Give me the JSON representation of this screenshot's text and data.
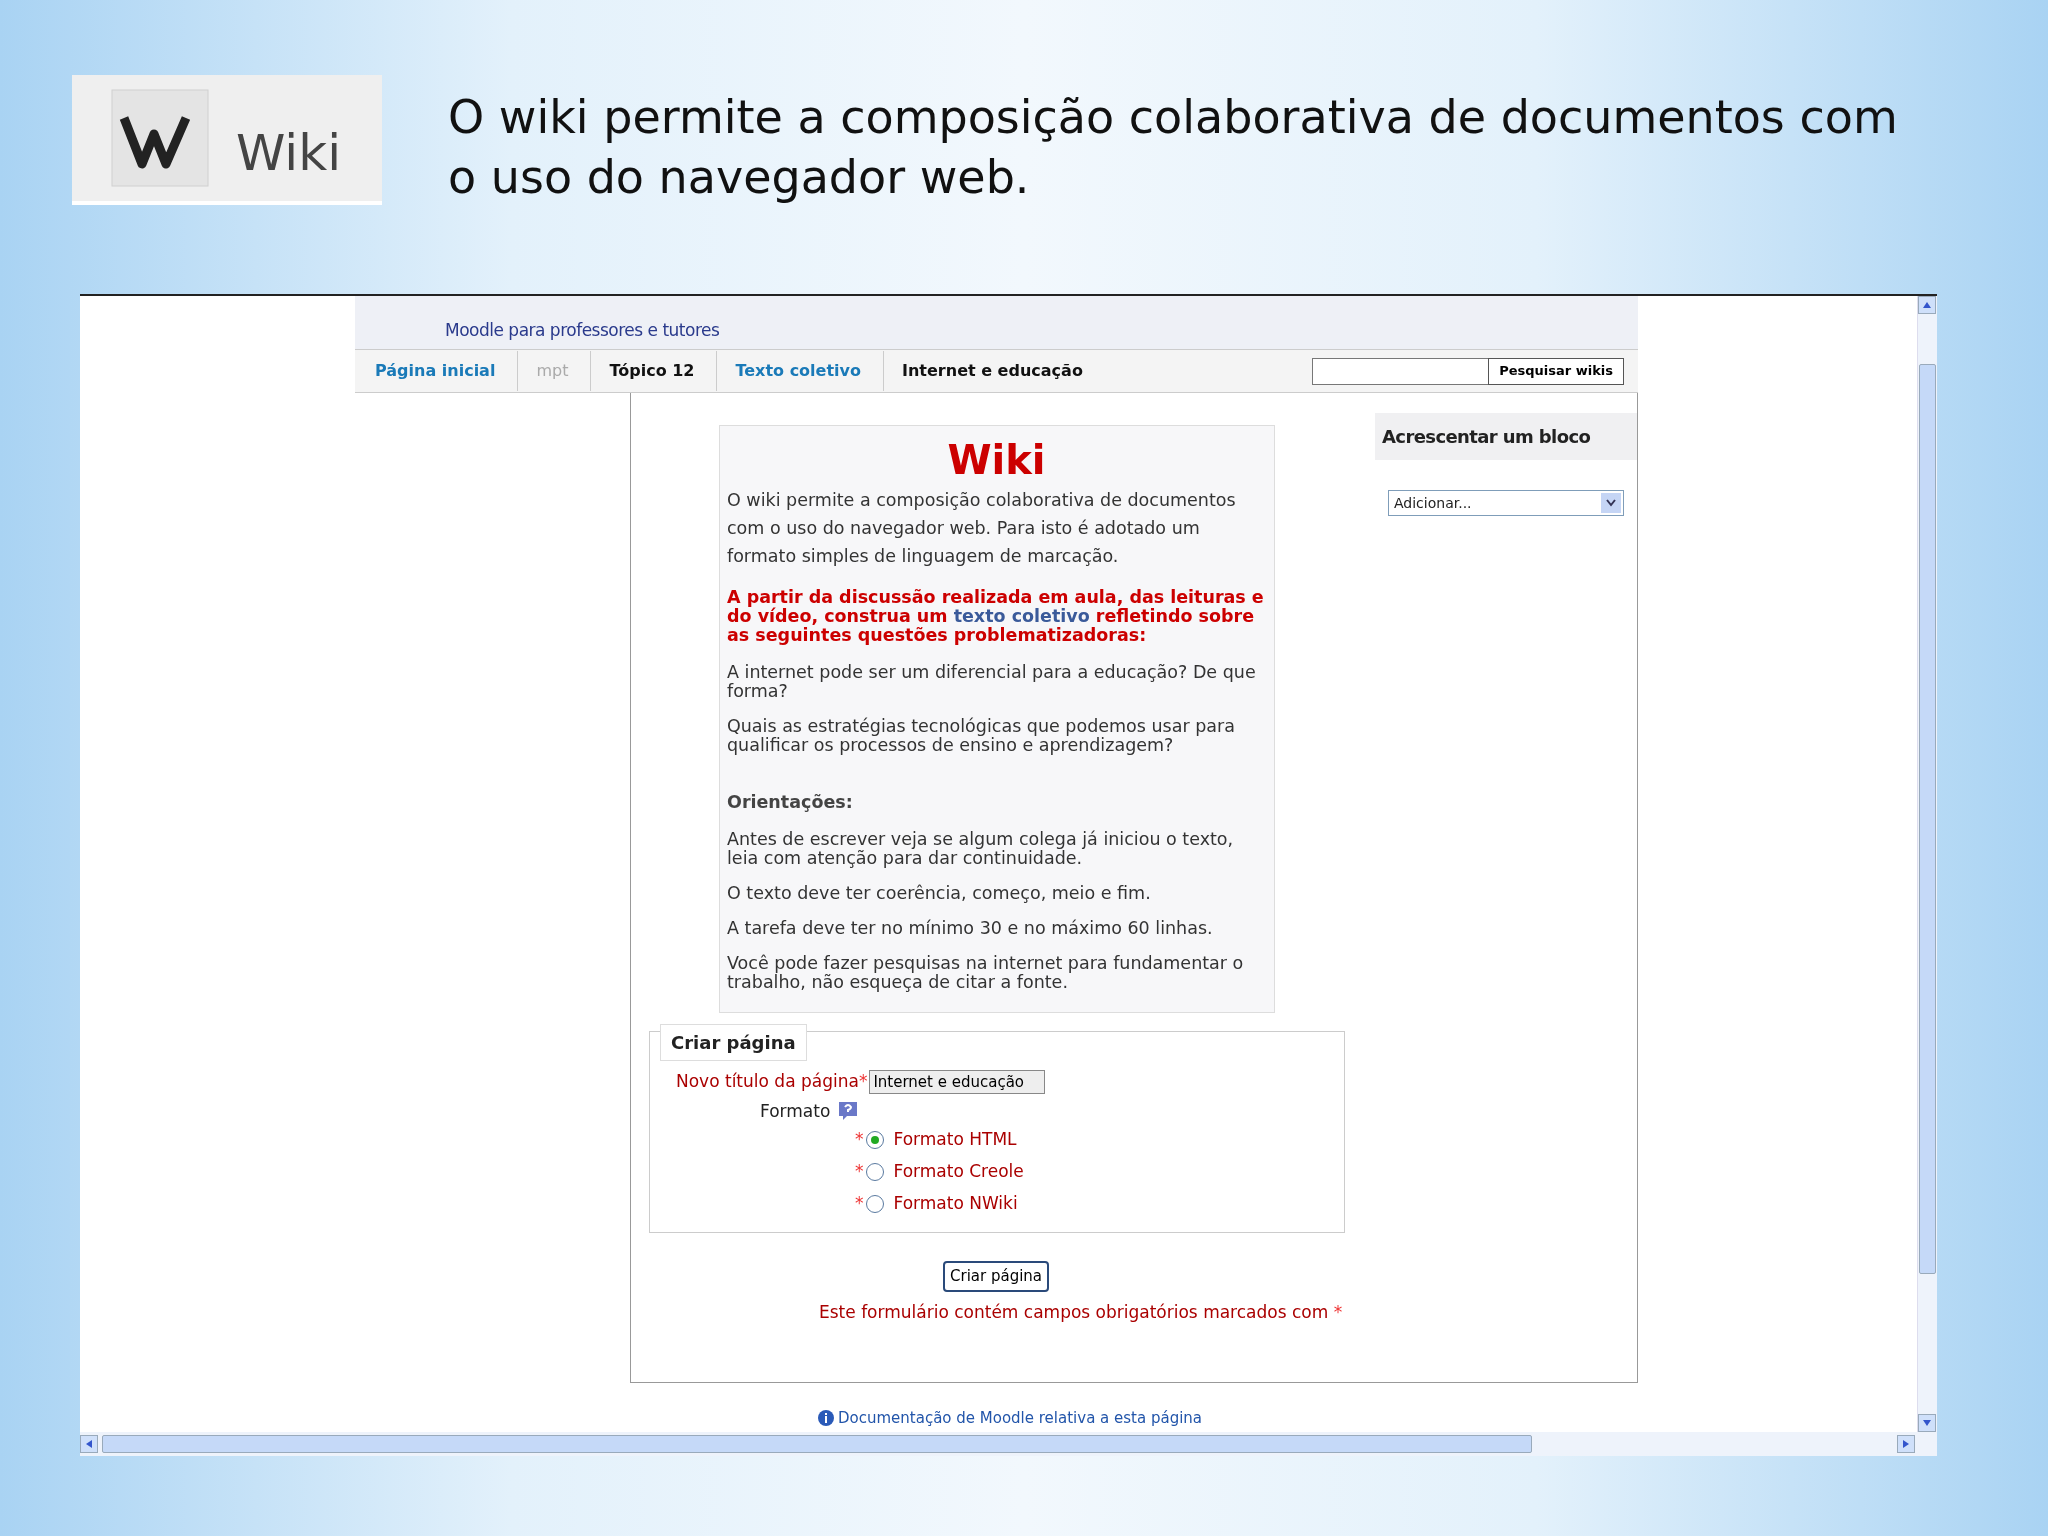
{
  "slide": {
    "logo_label": "Wiki",
    "title": "O wiki permite a composição colaborativa de documentos com o uso do navegador web."
  },
  "browser": {
    "site_name": "Moodle para professores e tutores",
    "breadcrumb": [
      {
        "label": "Página inicial",
        "kind": "link"
      },
      {
        "label": "mpt",
        "kind": "muted"
      },
      {
        "label": "Tópico 12",
        "kind": "plain"
      },
      {
        "label": "Texto coletivo",
        "kind": "link"
      },
      {
        "label": "Internet e educação",
        "kind": "plain"
      }
    ],
    "search_button": "Pesquisar wikis",
    "wiki": {
      "heading": "Wiki",
      "intro": "O wiki permite a composição colaborativa de documentos com o uso do navegador web. Para isto é adotado um formato simples de linguagem de marcação.",
      "prompt_before": "A partir da discussão realizada em aula, das leituras e do vídeo, construa um",
      "prompt_link": "texto coletivo",
      "prompt_after": "refletindo sobre as seguintes questões problematizadoras:",
      "questions": [
        "A internet pode ser um diferencial para a educação? De que forma?",
        "Quais as estratégias tecnológicas que podemos usar para qualificar os processos de ensino e aprendizagem?"
      ],
      "orientations_title": "Orientações:",
      "orientations": [
        "Antes de escrever veja se algum colega já iniciou o texto, leia com atenção para dar continuidade.",
        "O texto deve ter coerência, começo, meio e fim.",
        "A tarefa deve ter no mínimo 30 e no máximo 60 linhas.",
        "Você pode fazer pesquisas na internet para fundamentar o trabalho, não esqueça de citar a fonte."
      ]
    },
    "form": {
      "legend": "Criar página",
      "title_field": {
        "label": "Novo título da página",
        "mark": "*",
        "value": "Internet e educação"
      },
      "format_label": "Formato",
      "formats": [
        {
          "mark": "*",
          "label": "Formato HTML",
          "selected": true
        },
        {
          "mark": "*",
          "label": "Formato Creole",
          "selected": false
        },
        {
          "mark": "*",
          "label": "Formato NWiki",
          "selected": false
        }
      ],
      "submit": "Criar página",
      "required_note": {
        "text": "Este formulário contém campos obrigatórios marcados com",
        "mark": "*"
      }
    },
    "block": {
      "title": "Acrescentar um bloco",
      "select_value": "Adicionar..."
    },
    "footer_link": "Documentação de Moodle relativa a esta página"
  }
}
